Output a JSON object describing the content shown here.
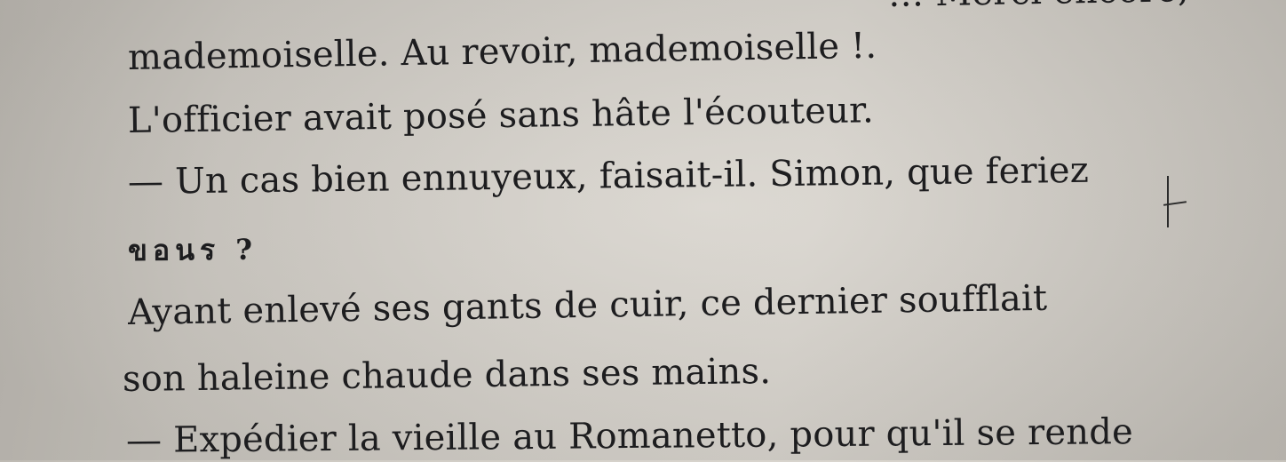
{
  "lines": [
    "… Merci encore,",
    "mademoiselle. Au revoir, mademoiselle !.",
    "L'officier avait posé sans hâte l'écouteur.",
    "— Un cas bien ennuyeux, faisait-il. Simon, que feriez",
    "ขอนร ?",
    "Ayant enlevé ses gants de cuir, ce dernier soufflait",
    "son haleine chaude dans ses mains.",
    "— Expédier la vieille au Romanetto, pour qu'il se rende"
  ]
}
